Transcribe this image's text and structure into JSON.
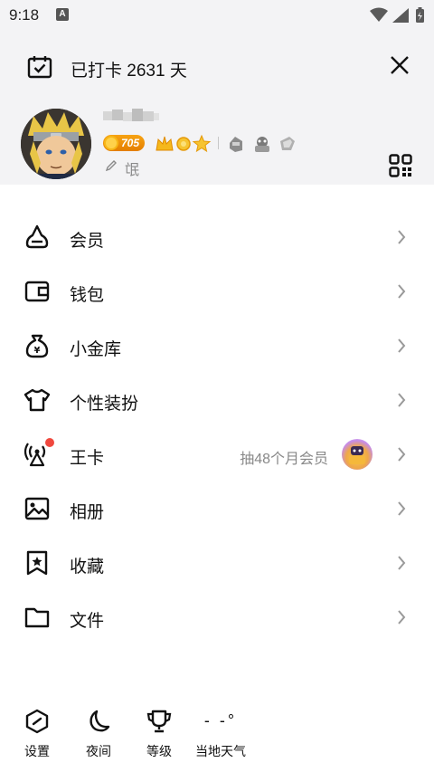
{
  "status_bar": {
    "time": "9:18",
    "notification_letter": "A"
  },
  "checkin": {
    "text": "已打卡 2631 天"
  },
  "profile": {
    "coin_value": "705",
    "signature": "氓"
  },
  "menu": {
    "items": [
      {
        "label": "会员",
        "icon": "member-icon"
      },
      {
        "label": "钱包",
        "icon": "wallet-icon"
      },
      {
        "label": "小金库",
        "icon": "money-bag-icon"
      },
      {
        "label": "个性装扮",
        "icon": "tshirt-icon"
      },
      {
        "label": "王卡",
        "icon": "signal-tower-icon",
        "extra": "抽48个月会员"
      },
      {
        "label": "相册",
        "icon": "photo-album-icon"
      },
      {
        "label": "收藏",
        "icon": "bookmark-star-icon"
      },
      {
        "label": "文件",
        "icon": "folder-icon"
      }
    ]
  },
  "bottom_bar": {
    "settings": "设置",
    "night": "夜间",
    "level": "等级",
    "weather": "当地天气",
    "weather_temp": "- -°"
  }
}
